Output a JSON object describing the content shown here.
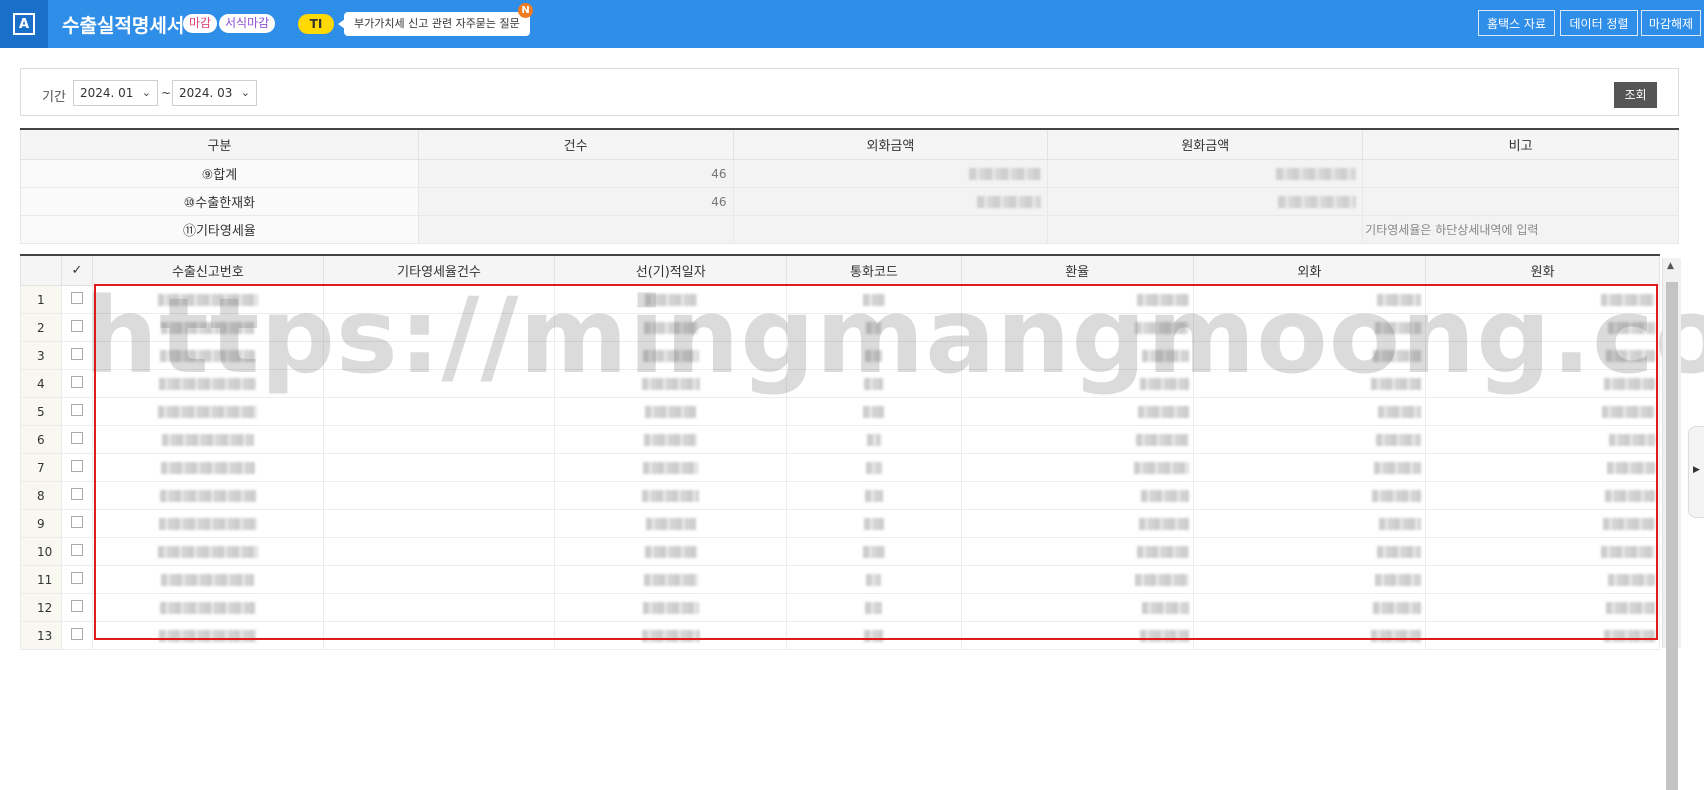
{
  "header": {
    "title": "수출실적명세서",
    "badge_close": "마감",
    "badge_form_close": "서식마감",
    "ti_badge": "TI",
    "bubble_text": "부가가치세 신고 관련 자주묻는 질문",
    "new_badge": "N",
    "buttons": {
      "hometax": "홈택스 자료",
      "sort": "데이터 정렬",
      "unclose": "마감해제"
    }
  },
  "filter": {
    "period_label": "기간",
    "from": "2024. 01",
    "to": "2024. 03",
    "tilde": "~",
    "search_button": "조회"
  },
  "summary": {
    "headers": [
      "구분",
      "건수",
      "외화금액",
      "원화금액",
      "비고"
    ],
    "rows": [
      {
        "label": "⑨합계",
        "count": "46",
        "note": ""
      },
      {
        "label": "⑩수출한재화",
        "count": "46",
        "note": ""
      },
      {
        "label": "⑪기타영세율",
        "count": "",
        "note": "기타영세율은 하단상세내역에 입력"
      }
    ]
  },
  "grid": {
    "check_header": "✓",
    "headers": [
      "수출신고번호",
      "기타영세율건수",
      "선(기)적일자",
      "통화코드",
      "환율",
      "외화",
      "원화"
    ],
    "row_numbers": [
      "1",
      "2",
      "3",
      "4",
      "5",
      "6",
      "7",
      "8",
      "9",
      "10",
      "11",
      "12",
      "13"
    ]
  },
  "watermark": "https://mingmangmoong.com/",
  "colors": {
    "header_bg": "#2f8ee8",
    "highlight_border": "#e01b1b",
    "search_button_bg": "#555555",
    "ti_badge_bg": "#ffd900",
    "new_badge_bg": "#f07b22"
  },
  "icons": {
    "logo": "app-logo-icon",
    "dropdown": "chevron-down-icon"
  }
}
